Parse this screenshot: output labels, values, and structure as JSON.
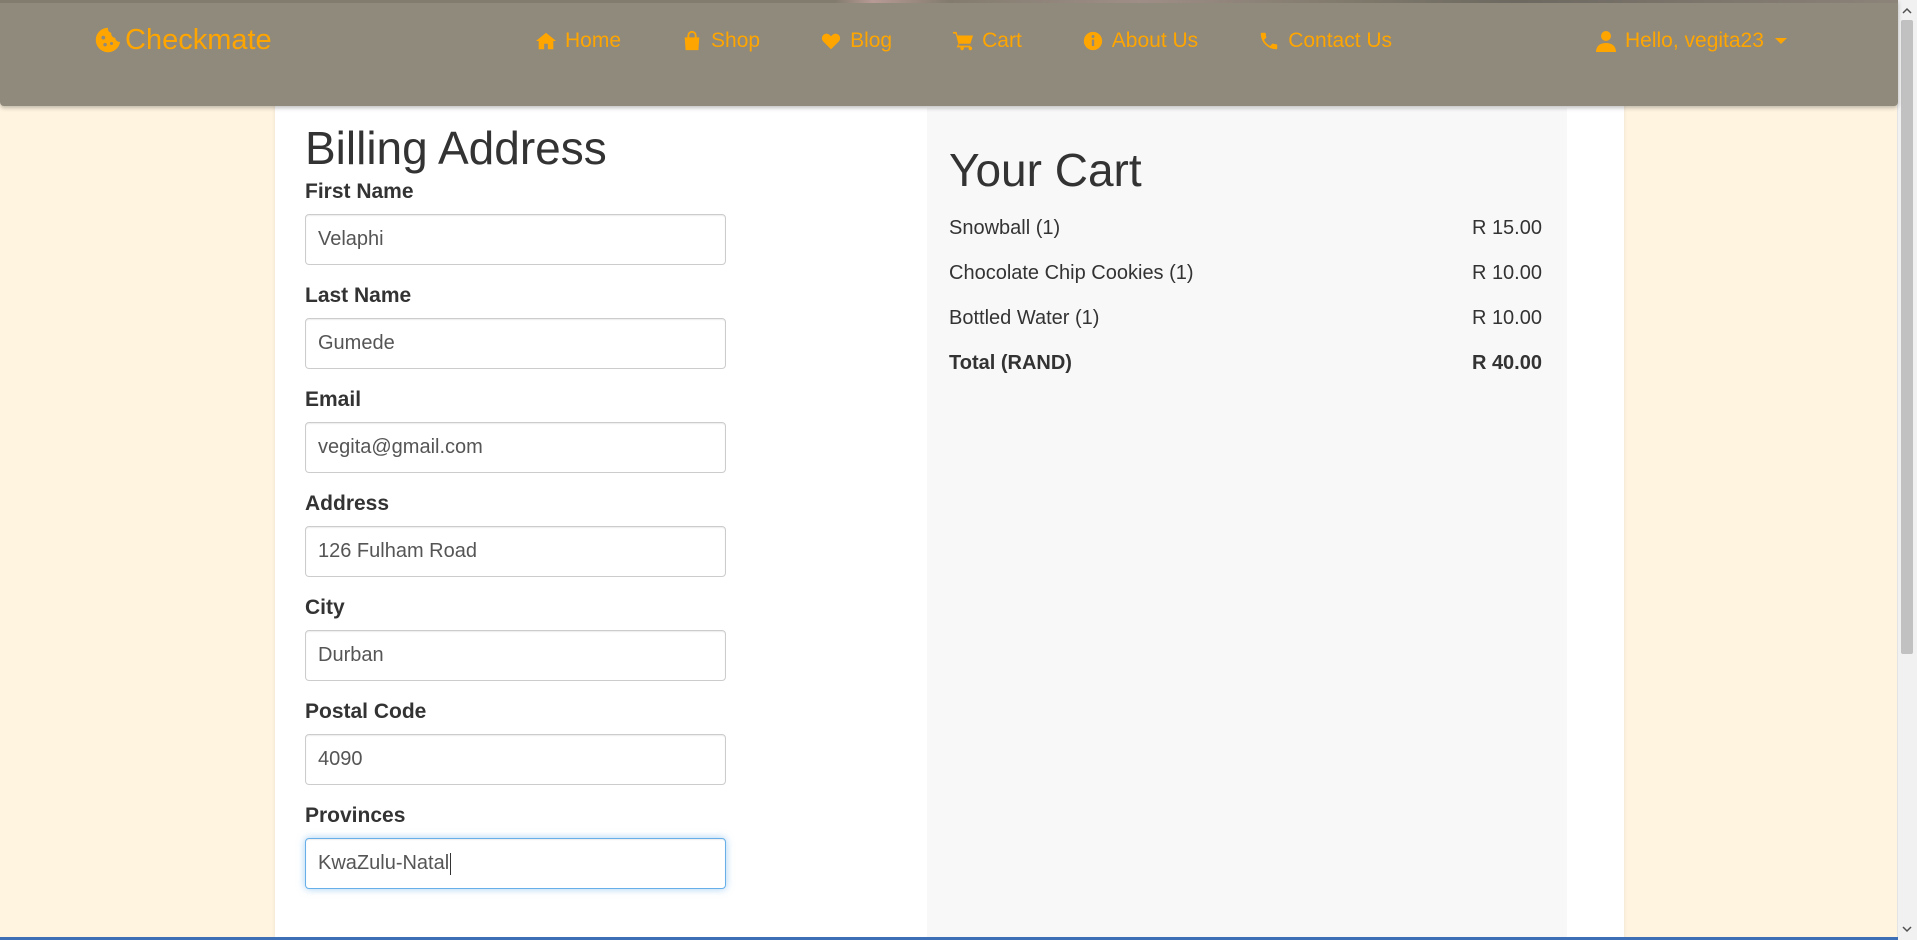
{
  "brand": {
    "name": "Checkmate",
    "color": "#ffa500"
  },
  "nav": {
    "items": [
      {
        "label": "Home",
        "icon": "home-icon"
      },
      {
        "label": "Shop",
        "icon": "shopping-bag-icon"
      },
      {
        "label": "Blog",
        "icon": "heart-icon"
      },
      {
        "label": "Cart",
        "icon": "cart-icon"
      },
      {
        "label": "About Us",
        "icon": "info-icon"
      },
      {
        "label": "Contact Us",
        "icon": "phone-icon"
      }
    ],
    "user_greeting": "Hello, vegita23"
  },
  "billing": {
    "title": "Billing Address",
    "fields": {
      "first_name": {
        "label": "First Name",
        "value": "Velaphi"
      },
      "last_name": {
        "label": "Last Name",
        "value": "Gumede"
      },
      "email": {
        "label": "Email",
        "value": "vegita@gmail.com"
      },
      "address": {
        "label": "Address",
        "value": "126 Fulham Road"
      },
      "city": {
        "label": "City",
        "value": "Durban"
      },
      "postal_code": {
        "label": "Postal Code",
        "value": "4090"
      },
      "provinces": {
        "label": "Provinces",
        "value": "KwaZulu-Natal"
      }
    }
  },
  "cart": {
    "title": "Your Cart",
    "items": [
      {
        "name": "Snowball (1)",
        "price": "R 15.00"
      },
      {
        "name": "Chocolate Chip Cookies (1)",
        "price": "R 10.00"
      },
      {
        "name": "Bottled Water (1)",
        "price": "R 10.00"
      }
    ],
    "total_label": "Total (RAND)",
    "total_value": "R 40.00"
  },
  "colors": {
    "accent": "#ffa500",
    "navbar_bg": "#8f8a7c",
    "page_bg": "#fff4e0",
    "cart_bg": "#f8f8f8",
    "focus_border": "#66afe9"
  }
}
